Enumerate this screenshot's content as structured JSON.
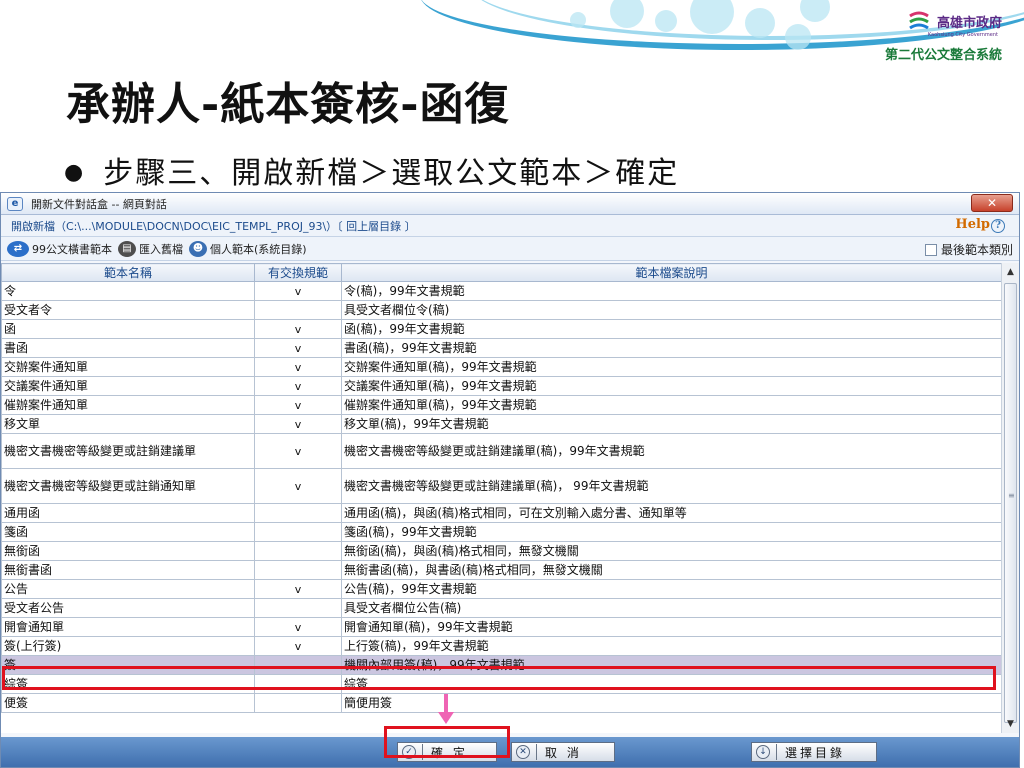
{
  "slide": {
    "logo_name": "高雄市政府",
    "logo_en": "Kaohsiung City Government",
    "logo_system": "第二代公文整合系統",
    "title": "承辦人-紙本簽核-函復",
    "bullet": "步驟三、開啟新檔＞選取公文範本＞確定"
  },
  "dialog": {
    "window_title": "開新文件對話盒 -- 網頁對話",
    "path_text": "開啟新檔（C:\\...\\MODULE\\DOCN\\DOC\\EIC_TEMPL_PROJ_93\\）〔 回上層目錄 〕",
    "help": "Help",
    "toolbar": {
      "item1": "99公文橫書範本",
      "item2": "匯入舊檔",
      "item3": "個人範本(系統目錄)",
      "last_category": "最後範本類別"
    },
    "columns": {
      "name": "範本名稱",
      "exchange": "有交換規範",
      "desc": "範本檔案說明"
    },
    "rows": [
      {
        "name": "令",
        "mark": "v",
        "desc": "令(稿)，99年文書規範"
      },
      {
        "name": "受文者令",
        "mark": "",
        "desc": "具受文者欄位令(稿)"
      },
      {
        "name": "函",
        "mark": "v",
        "desc": "函(稿)，99年文書規範"
      },
      {
        "name": "書函",
        "mark": "v",
        "desc": "書函(稿)，99年文書規範"
      },
      {
        "name": "交辦案件通知單",
        "mark": "v",
        "desc": "交辦案件通知單(稿)，99年文書規範"
      },
      {
        "name": "交議案件通知單",
        "mark": "v",
        "desc": "交議案件通知單(稿)，99年文書規範"
      },
      {
        "name": "催辦案件通知單",
        "mark": "v",
        "desc": "催辦案件通知單(稿)，99年文書規範"
      },
      {
        "name": "移文單",
        "mark": "v",
        "desc": "移文單(稿)，99年文書規範"
      },
      {
        "name": "機密文書機密等級變更或註銷建議單",
        "mark": "v",
        "desc": "機密文書機密等級變更或註銷建議單(稿)，99年文書規範"
      },
      {
        "name": "機密文書機密等級變更或註銷通知單",
        "mark": "v",
        "desc": "機密文書機密等級變更或註銷建議單(稿)， 99年文書規範"
      },
      {
        "name": "通用函",
        "mark": "",
        "desc": "通用函(稿)，與函(稿)格式相同，可在文別輸入處分書、通知單等"
      },
      {
        "name": "箋函",
        "mark": "",
        "desc": "箋函(稿)，99年文書規範"
      },
      {
        "name": "無銜函",
        "mark": "",
        "desc": "無銜函(稿)，與函(稿)格式相同，無發文機關"
      },
      {
        "name": "無銜書函",
        "mark": "",
        "desc": "無銜書函(稿)，與書函(稿)格式相同，無發文機關"
      },
      {
        "name": "公告",
        "mark": "v",
        "desc": "公告(稿)，99年文書規範"
      },
      {
        "name": "受文者公告",
        "mark": "",
        "desc": "具受文者欄位公告(稿)"
      },
      {
        "name": "開會通知單",
        "mark": "v",
        "desc": "開會通知單(稿)，99年文書規範"
      },
      {
        "name": "簽(上行簽)",
        "mark": "v",
        "desc": "上行簽(稿)，99年文書規範"
      },
      {
        "name": "簽",
        "mark": "",
        "desc": "機關內部用簽(稿)，99年文書規範"
      },
      {
        "name": "綜簽",
        "mark": "",
        "desc": "綜簽"
      },
      {
        "name": "便簽",
        "mark": "",
        "desc": "簡便用簽"
      }
    ],
    "buttons": {
      "ok": "確 定",
      "cancel": "取 消",
      "select_dir": "選擇目錄"
    }
  }
}
